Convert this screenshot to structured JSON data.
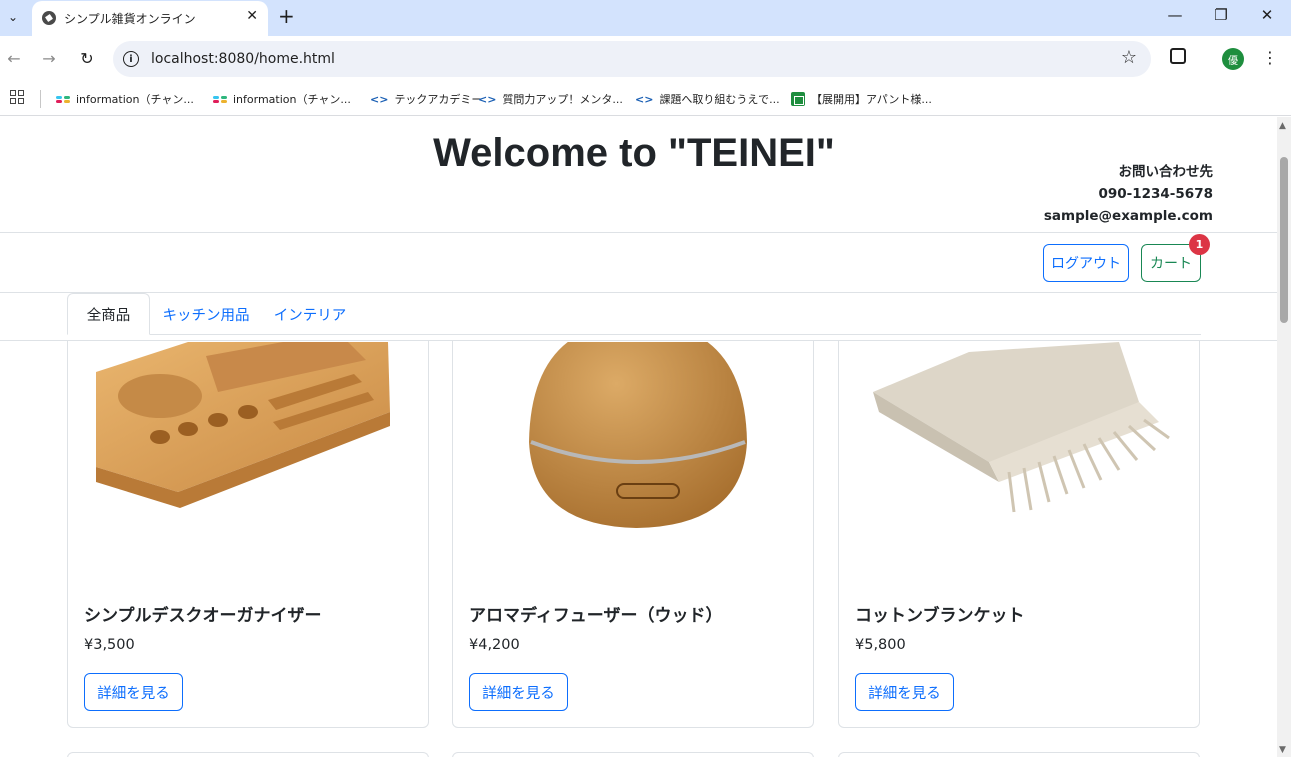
{
  "browser": {
    "tab_title": "シンプル雑貨オンライン",
    "url": "localhost:8080/home.html",
    "profile_initial": "優",
    "bookmarks": [
      {
        "label": "information（チャン...",
        "icon": "slack-icon"
      },
      {
        "label": "information（チャン...",
        "icon": "slack-icon"
      },
      {
        "label": "テックアカデミー",
        "icon": "code-icon"
      },
      {
        "label": "質問力アップ！メンタ...",
        "icon": "code-icon"
      },
      {
        "label": "課題へ取り組むうえで...",
        "icon": "code-icon"
      },
      {
        "label": "【展開用】アパント様...",
        "icon": "sheets-icon"
      }
    ]
  },
  "header": {
    "title": "Welcome to \"TEINEI\"",
    "contact_label": "お問い合わせ先",
    "contact_phone": "090-1234-5678",
    "contact_email": "sample@example.com"
  },
  "actions": {
    "logout_label": "ログアウト",
    "cart_label": "カート",
    "cart_count": "1"
  },
  "category_tabs": [
    {
      "label": "全商品",
      "active": true
    },
    {
      "label": "キッチン用品",
      "active": false
    },
    {
      "label": "インテリア",
      "active": false
    }
  ],
  "products": [
    {
      "name": "シンプルデスクオーガナイザー",
      "price": "¥3,500",
      "button": "詳細を見る"
    },
    {
      "name": "アロマディフューザー（ウッド）",
      "price": "¥4,200",
      "button": "詳細を見る"
    },
    {
      "name": "コットンブランケット",
      "price": "¥5,800",
      "button": "詳細を見る"
    }
  ],
  "colors": {
    "primary": "#0d6efd",
    "success": "#198754",
    "danger": "#dc3545",
    "chrome_tab_bar": "#d3e3fd"
  }
}
